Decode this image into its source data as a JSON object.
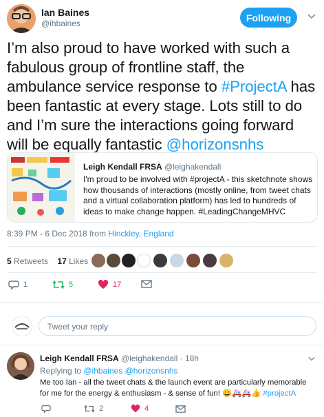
{
  "header": {
    "display_name": "Ian Baines",
    "handle": "@ihbaines",
    "follow_label": "Following"
  },
  "tweet": {
    "text_before_tag": "I’m also proud to have worked with such a fabulous group of frontline staff, the ambulance service response to ",
    "hashtag": "#ProjectA",
    "text_after_tag": " has been fantastic at every stage. Lots still to do and I’m sure the interactions going forward will be equally fantastic ",
    "mention": "@horizonsnhs"
  },
  "quoted": {
    "name": "Leigh Kendall FRSA",
    "handle": "@leighakendall",
    "text": "I'm proud to be involved with #projectA - this sketchnote shows how thousands of interactions (mostly online, from tweet chats and a virtual collaboration platform) has led to hundreds of ideas to make change happen. #LeadingChangeMHVC"
  },
  "meta": {
    "time": "8:39 PM - 6 Dec 2018 from ",
    "location": "Hinckley, England"
  },
  "stats": {
    "retweets_count": "5",
    "retweets_label": "Retweets",
    "likes_count": "17",
    "likes_label": "Likes"
  },
  "actions": {
    "reply_count": "1",
    "retweet_count": "5",
    "like_count": "17"
  },
  "compose": {
    "placeholder": "Tweet your reply"
  },
  "reply": {
    "name": "Leigh Kendall FRSA",
    "handle": "@leighakendall",
    "time": "· 18h",
    "replying_prefix": "Replying to ",
    "replying_handles": "@ihbaines @horizonsnhs",
    "text": "Me too Ian - all the tweet chats & the launch event are particularly memorable for me for the energy & enthusiasm - & sense of fun! ",
    "emoji": "😀🚑🚑👍",
    "hashtag": "#projectA",
    "reply_count": "",
    "retweet_count": "2",
    "like_count": "4"
  },
  "colors": {
    "accent": "#1da1f2",
    "like": "#e0245e",
    "retweet": "#17bf63",
    "muted": "#657786"
  }
}
